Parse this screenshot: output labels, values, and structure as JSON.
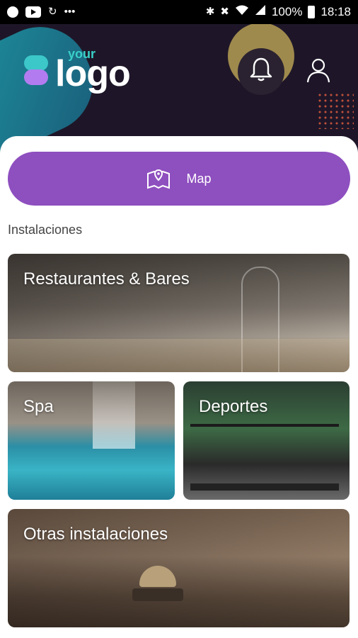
{
  "status_bar": {
    "battery_text": "100%",
    "time": "18:18",
    "icons": [
      "notification-dot-icon",
      "youtube-icon",
      "sync-icon",
      "more-icon",
      "bluetooth-icon",
      "mute-icon",
      "wifi-icon",
      "signal-icon",
      "battery-icon"
    ]
  },
  "header": {
    "logo_small": "your",
    "logo_main": "logo",
    "colors": {
      "background": "#1e1628",
      "accent_teal": "#1d8f9c",
      "bell_highlight": "#9f8a4d",
      "dots": "#c0503a"
    }
  },
  "map_button": {
    "label": "Map",
    "color": "#8e4fbf"
  },
  "section": {
    "title": "Instalaciones"
  },
  "tiles": [
    {
      "label": "Restaurantes & Bares"
    },
    {
      "label": "Spa"
    },
    {
      "label": "Deportes"
    },
    {
      "label": "Otras instalaciones"
    }
  ]
}
